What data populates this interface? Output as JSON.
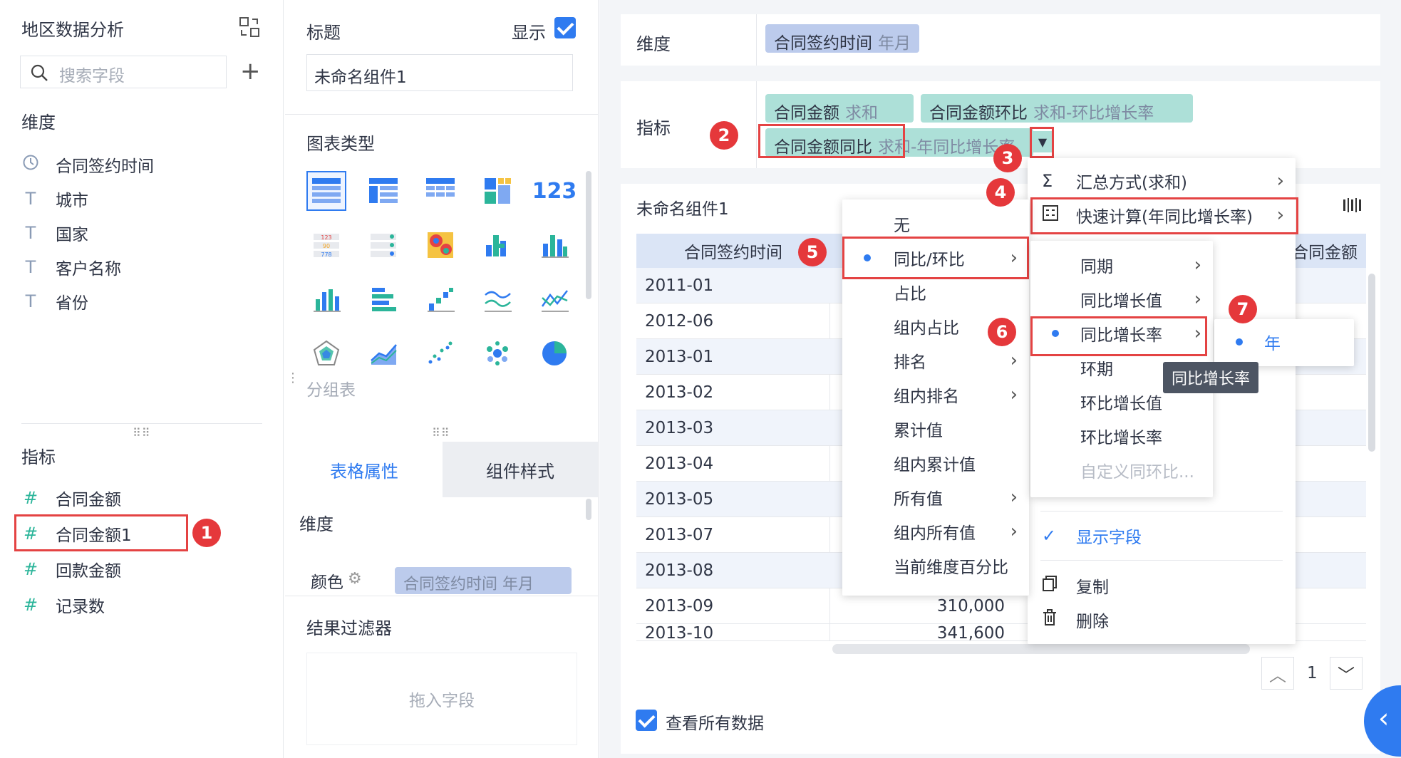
{
  "left": {
    "title": "地区数据分析",
    "search_placeholder": "搜索字段",
    "dimensions_label": "维度",
    "dimensions": [
      "合同签约时间",
      "城市",
      "国家",
      "客户名称",
      "省份"
    ],
    "metrics_label": "指标",
    "metrics": [
      "合同金额",
      "合同金额1",
      "回款金额",
      "记录数"
    ]
  },
  "mid": {
    "title_label": "标题",
    "show_label": "显示",
    "title_value": "未命名组件1",
    "chart_type_label": "图表类型",
    "chart_type_caption": "分组表",
    "tabs": [
      "表格属性",
      "组件样式"
    ],
    "dim_label": "维度",
    "color_label": "颜色",
    "color_pill": "合同签约时间 年月",
    "filter_label": "结果过滤器",
    "drop_hint": "拖入字段"
  },
  "right": {
    "dim_row_label": "维度",
    "dim_pill": {
      "name": "合同签约时间",
      "sub": "年月"
    },
    "metric_row_label": "指标",
    "metric_pills": [
      {
        "name": "合同金额",
        "sub": "求和"
      },
      {
        "name": "合同金额环比",
        "sub": "求和-环比增长率"
      },
      {
        "name": "合同金额同比",
        "sub": "求和-年同比增长率"
      }
    ],
    "widget_title": "未命名组件1",
    "table_headers": [
      "合同签约时间",
      "合同金额"
    ],
    "table_rows": [
      {
        "date": "2011-01",
        "value": ""
      },
      {
        "date": "2012-06",
        "value": ""
      },
      {
        "date": "2013-01",
        "value": ""
      },
      {
        "date": "2013-02",
        "value": ""
      },
      {
        "date": "2013-03",
        "value": ""
      },
      {
        "date": "2013-04",
        "value": ""
      },
      {
        "date": "2013-05",
        "value": ""
      },
      {
        "date": "2013-07",
        "value": ""
      },
      {
        "date": "2013-08",
        "value": ""
      },
      {
        "date": "2013-09",
        "value": "310,000"
      },
      {
        "date": "2013-10",
        "value": "341,600"
      }
    ],
    "page_number": "1",
    "view_all_label": "查看所有数据"
  },
  "menu_main": {
    "items": [
      "汇总方式(求和)",
      "快速计算(年同比增长率)",
      "显示字段",
      "复制",
      "删除"
    ]
  },
  "menu_calc": {
    "items": [
      "无",
      "同比/环比",
      "占比",
      "组内占比",
      "排名",
      "组内排名",
      "累计值",
      "组内累计值",
      "所有值",
      "组内所有值",
      "当前维度百分比"
    ]
  },
  "menu_yoy": {
    "items": [
      "同期",
      "同比增长值",
      "同比增长率",
      "环期",
      "环比增长值",
      "环比增长率",
      "自定义同环比..."
    ]
  },
  "menu_year": {
    "items": [
      "年"
    ]
  },
  "tooltip": "同比增长率",
  "badges": [
    "1",
    "2",
    "3",
    "4",
    "5",
    "6",
    "7"
  ],
  "colors": {
    "accent": "#2f7bf0",
    "callout": "#e5383b",
    "teal_pill": "#ade0d8",
    "blue_pill": "#bccbec"
  }
}
